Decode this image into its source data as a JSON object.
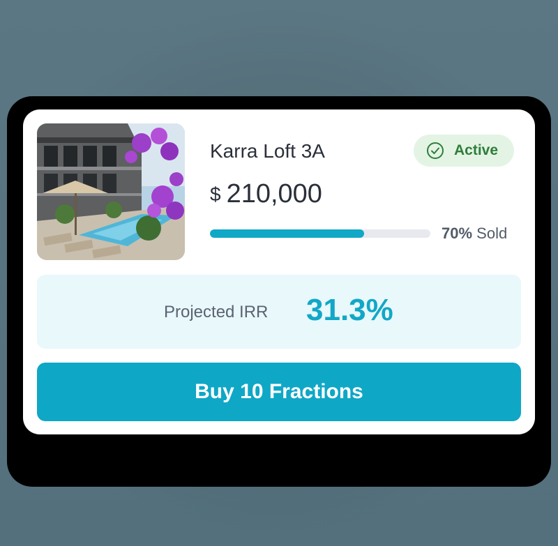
{
  "listing": {
    "title": "Karra Loft 3A",
    "currency_symbol": "$",
    "price": "210,000",
    "status": {
      "label": "Active",
      "icon": "check-circle-icon",
      "color": "#2f7d3a",
      "background": "#e3f4e4"
    },
    "progress": {
      "fraction_sold": 0.7,
      "percent_text": "70%",
      "suffix": "Sold"
    },
    "image_description_icon": "property-photo"
  },
  "metrics": {
    "irr_label": "Projected IRR",
    "irr_value": "31.3%"
  },
  "action": {
    "buy_label": "Buy 10 Fractions"
  },
  "colors": {
    "accent": "#0fa7c6",
    "irr_background": "#e8f8fb",
    "text_dark": "#2a2f3a"
  }
}
